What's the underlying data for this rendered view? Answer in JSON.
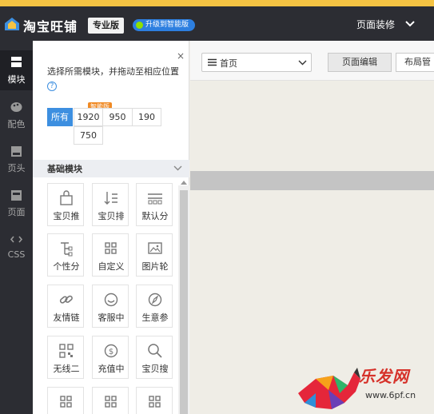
{
  "app": {
    "logo_text": "淘宝旺铺",
    "edition_badge": "专业版",
    "upgrade_badge": "升级到智能版",
    "top_right_menu": "页面装修"
  },
  "rail": [
    {
      "label": "模块",
      "icon": "grid-icon",
      "active": true
    },
    {
      "label": "配色",
      "icon": "palette-icon",
      "active": false
    },
    {
      "label": "页头",
      "icon": "header-icon",
      "active": false
    },
    {
      "label": "页面",
      "icon": "page-icon",
      "active": false
    },
    {
      "label": "CSS",
      "icon": "code-icon",
      "active": false
    }
  ],
  "panel": {
    "close": "×",
    "hint": "选择所需模块，并拖动至相应位置",
    "help": "?",
    "filters": [
      "所有",
      "1920",
      "950",
      "190",
      "750"
    ],
    "active_filter": "所有",
    "smart_tag": "智能版",
    "section_title": "基础模块",
    "modules": [
      {
        "label": "宝贝推",
        "icon": "bag-icon"
      },
      {
        "label": "宝贝排",
        "icon": "sort-icon"
      },
      {
        "label": "默认分",
        "icon": "category-icon"
      },
      {
        "label": "个性分",
        "icon": "tree-icon"
      },
      {
        "label": "自定义",
        "icon": "custom-grid-icon"
      },
      {
        "label": "图片轮",
        "icon": "image-carousel-icon"
      },
      {
        "label": "友情链",
        "icon": "link-icon"
      },
      {
        "label": "客服中",
        "icon": "service-icon"
      },
      {
        "label": "生意参",
        "icon": "compass-icon"
      },
      {
        "label": "无线二",
        "icon": "qrcode-icon"
      },
      {
        "label": "充值中",
        "icon": "dollar-icon"
      },
      {
        "label": "宝贝搜",
        "icon": "search-icon"
      }
    ]
  },
  "main": {
    "page_select_value": "首页",
    "tabs": [
      {
        "label": "页面编辑",
        "active": true
      },
      {
        "label": "布局管",
        "active": false
      }
    ]
  },
  "watermark": {
    "text": "乐发网",
    "url": "www.6pf.cn"
  },
  "colors": {
    "topbar": "#2c2d33",
    "accent_blue": "#3d8fe0",
    "smart_orange": "#f08a24",
    "top_stripe": "#f5c343"
  }
}
